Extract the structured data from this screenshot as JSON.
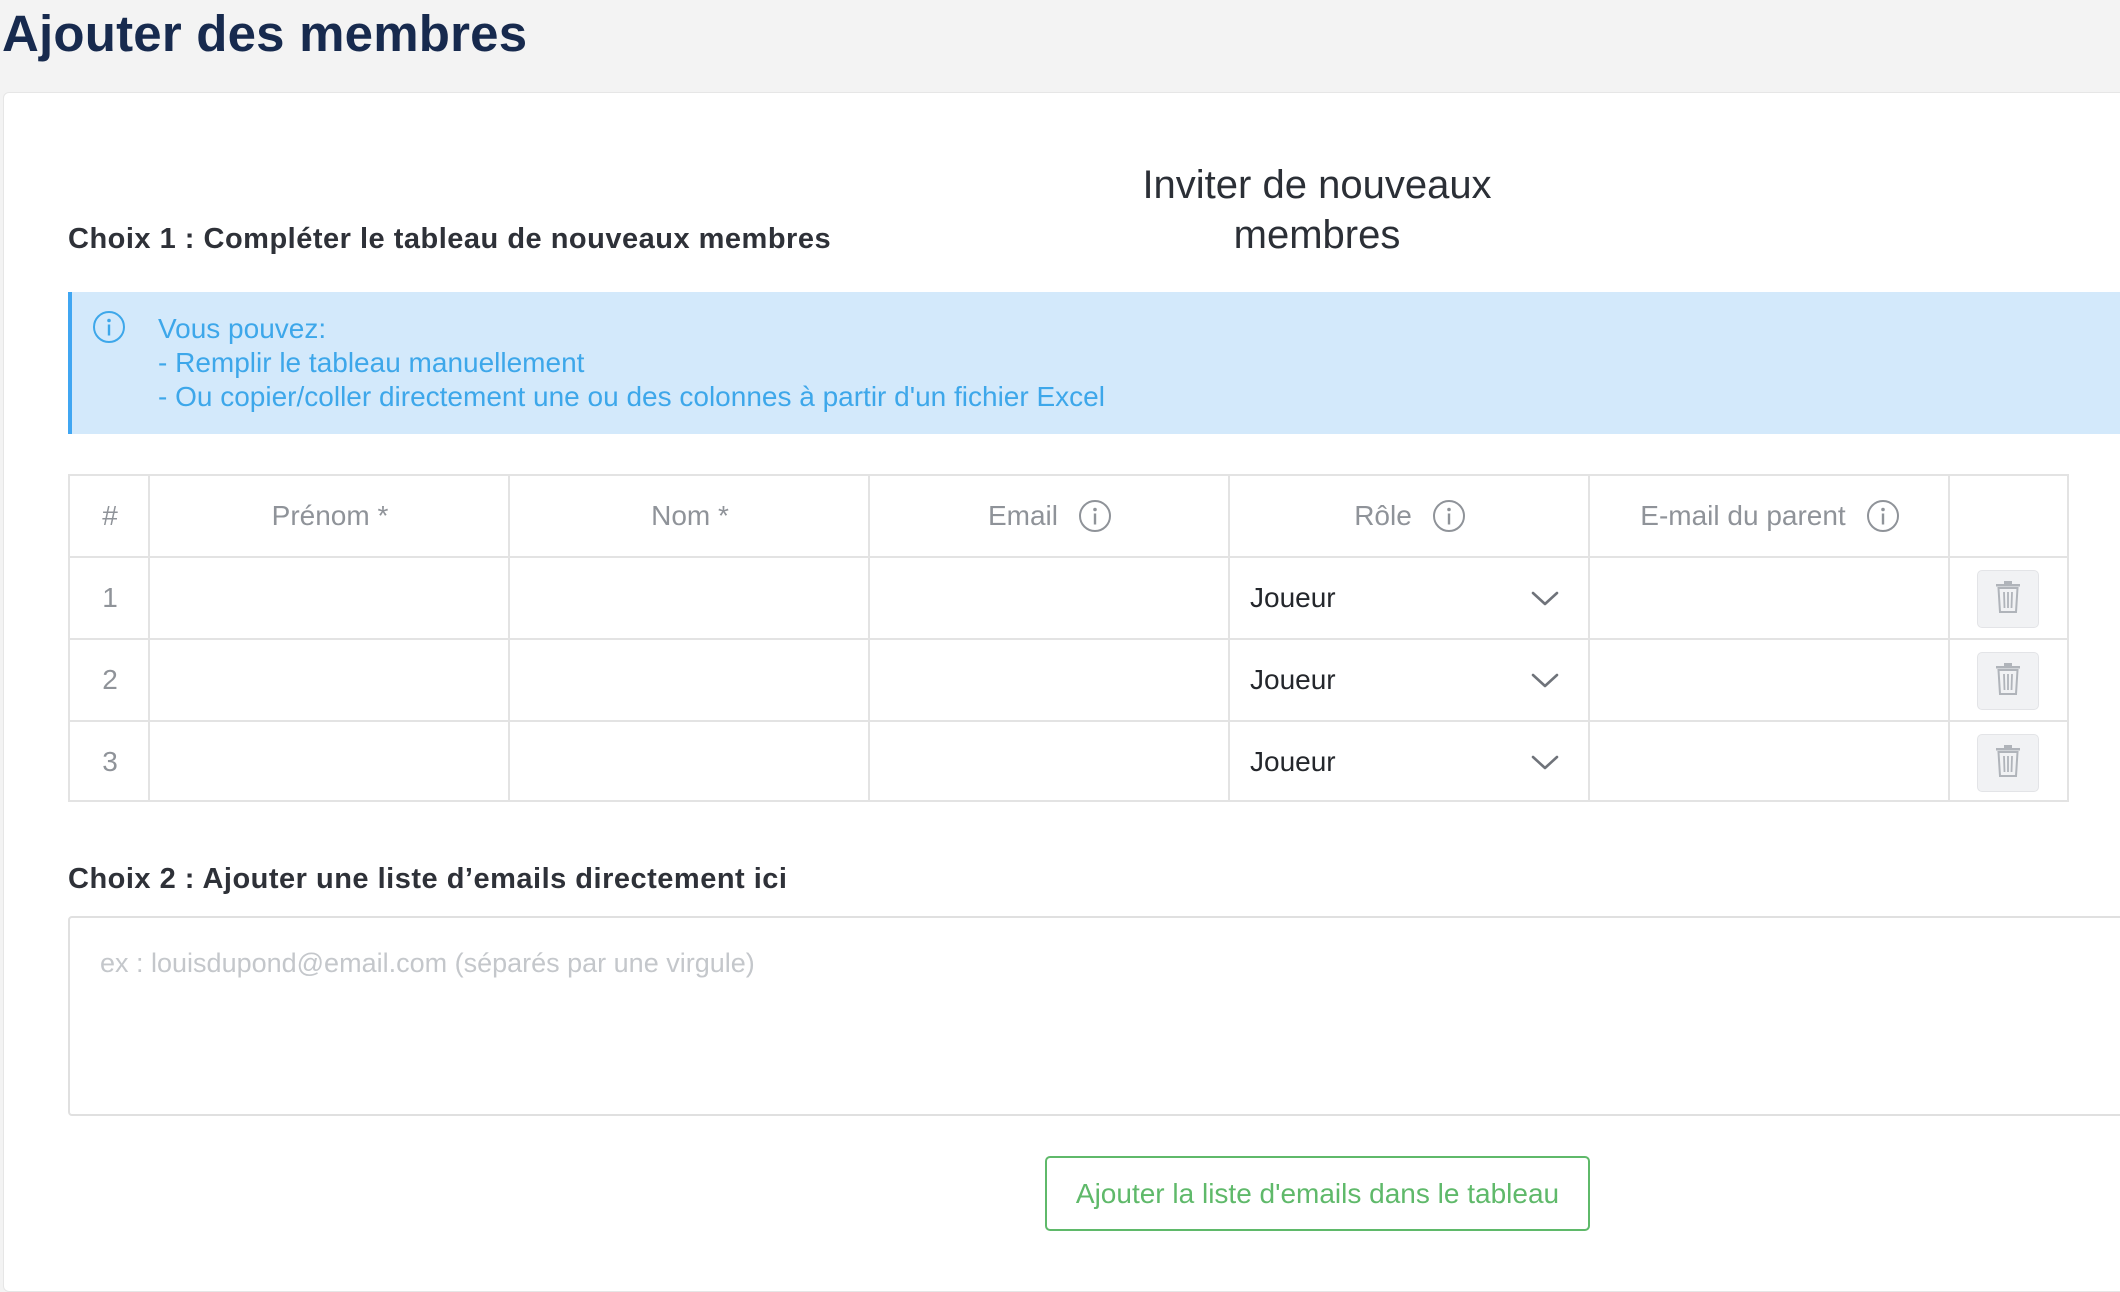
{
  "page": {
    "title": "Ajouter des membres"
  },
  "card": {
    "title": "Inviter de nouveaux membres"
  },
  "choice1": {
    "heading": "Choix 1 : Compléter le tableau de nouveaux membres",
    "info": {
      "icon": "info-circle-icon",
      "lines": [
        "Vous pouvez:",
        "- Remplir le tableau manuellement",
        "- Ou copier/coller directement une ou des colonnes à partir d'un fichier Excel"
      ]
    }
  },
  "table": {
    "columns": [
      "#",
      "Prénom *",
      "Nom *",
      "Email",
      "Rôle",
      "E-mail du parent",
      ""
    ],
    "rows": [
      {
        "index": "1",
        "first_name": "",
        "last_name": "",
        "email": "",
        "role": "Joueur",
        "parent_email": ""
      },
      {
        "index": "2",
        "first_name": "",
        "last_name": "",
        "email": "",
        "role": "Joueur",
        "parent_email": ""
      },
      {
        "index": "3",
        "first_name": "",
        "last_name": "",
        "email": "",
        "role": "Joueur",
        "parent_email": ""
      }
    ]
  },
  "choice2": {
    "heading": "Choix 2 : Ajouter une liste d’emails directement ici",
    "textarea_placeholder": "ex : louisdupond@email.com (séparés par une virgule)",
    "button_label": "Ajouter la liste d'emails dans le tableau"
  },
  "colors": {
    "title": "#172a4e",
    "info_bg": "#d3e9fb",
    "info_text": "#3da7ea",
    "button_green": "#5fb96a"
  }
}
